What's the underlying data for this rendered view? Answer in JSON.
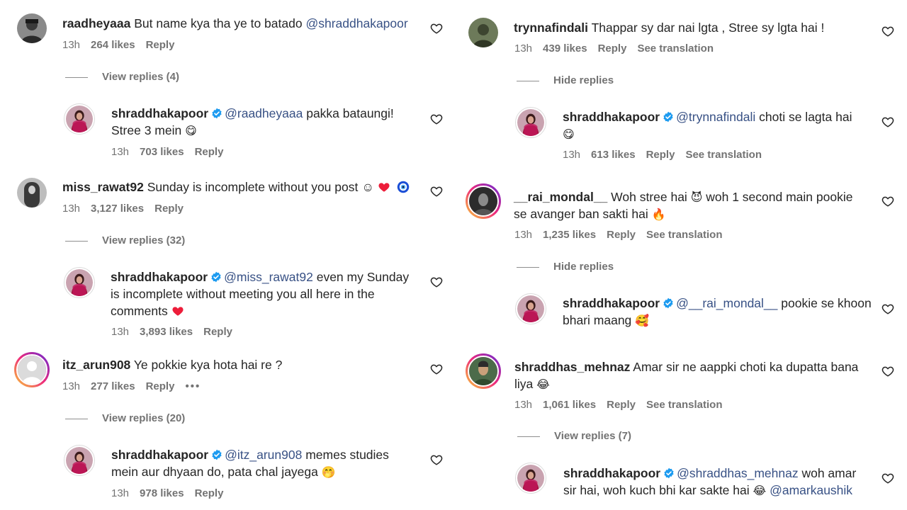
{
  "colors": {
    "mention": "#385185",
    "verified": "#1d9bf0",
    "meta": "#737373",
    "heart_red": "#ed1d3a"
  },
  "left": {
    "c1": {
      "user": "raadheyaaa",
      "text": "But name kya tha ye to batado ",
      "mention": "@shraddhakapoor",
      "time": "13h",
      "likes": "264 likes",
      "reply": "Reply"
    },
    "t1": {
      "label": "View replies (4)"
    },
    "r1": {
      "user": "shraddhakapoor",
      "mention": "@raadheyaaa",
      "text_a": " pakka bataungi!",
      "text_b": "Stree 3 mein ",
      "emoji": "😋",
      "time": "13h",
      "likes": "703 likes",
      "reply": "Reply"
    },
    "c2": {
      "user": "miss_rawat92",
      "text": "Sunday is incomplete without you post ☺ ",
      "time": "13h",
      "likes": "3,127 likes",
      "reply": "Reply"
    },
    "t2": {
      "label": "View replies (32)"
    },
    "r2": {
      "user": "shraddhakapoor",
      "mention": "@miss_rawat92",
      "text_a": " even my Sunday",
      "text_b": "is incomplete without meeting you all here in the",
      "text_c": "comments ",
      "time": "13h",
      "likes": "3,893 likes",
      "reply": "Reply"
    },
    "c3": {
      "user": "itz_arun908",
      "text": "Ye pokkie kya hota hai re ?",
      "time": "13h",
      "likes": "277 likes",
      "reply": "Reply",
      "more": "•••"
    },
    "t3": {
      "label": "View replies (20)"
    },
    "r3": {
      "user": "shraddhakapoor",
      "mention": "@itz_arun908",
      "text_a": " memes studies",
      "text_b": "mein aur dhyaan do, pata chal jayega ",
      "emoji": "🤭",
      "time": "13h",
      "likes": "978 likes",
      "reply": "Reply"
    }
  },
  "right": {
    "c1": {
      "user": "trynnafindali",
      "text": "Thappar sy dar nai lgta , Stree sy lgta hai !",
      "time": "13h",
      "likes": "439 likes",
      "reply": "Reply",
      "see": "See translation"
    },
    "t1": {
      "label": "Hide replies"
    },
    "r1": {
      "user": "shraddhakapoor",
      "mention": "@trynnafindali",
      "text_a": " choti se lagta hai",
      "emoji": "😋",
      "time": "13h",
      "likes": "613 likes",
      "reply": "Reply",
      "see": "See translation"
    },
    "c2": {
      "user": "__rai_mondal__",
      "text_a": "Woh stree hai ",
      "text_b": " woh 1 second main pookie",
      "text_c": "se avanger ban sakti hai ",
      "emoji1": "😈",
      "emoji2": "🔥",
      "time": "13h",
      "likes": "1,235 likes",
      "reply": "Reply",
      "see": "See translation"
    },
    "t2": {
      "label": "Hide replies"
    },
    "r2": {
      "user": "shraddhakapoor",
      "mention": "@__rai_mondal__",
      "text_a": " pookie se khoon",
      "text_b": "bhari maang ",
      "emoji": "🥰",
      "time": "13h",
      "likes": "",
      "reply": ""
    },
    "c3": {
      "user": "shraddhas_mehnaz",
      "text_a": "Amar sir ne aappki choti ka dupatta bana",
      "text_b": "liya ",
      "emoji": "😂",
      "time": "13h",
      "likes": "1,061 likes",
      "reply": "Reply",
      "see": "See translation"
    },
    "t3": {
      "label": "View replies (7)"
    },
    "r3": {
      "user": "shraddhakapoor",
      "mention": "@shraddhas_mehnaz",
      "text_a": " woh amar",
      "text_b": "sir hai, woh kuch bhi kar sakte hai ",
      "emoji": "😂",
      "mention2": "@amarkaushik"
    }
  }
}
